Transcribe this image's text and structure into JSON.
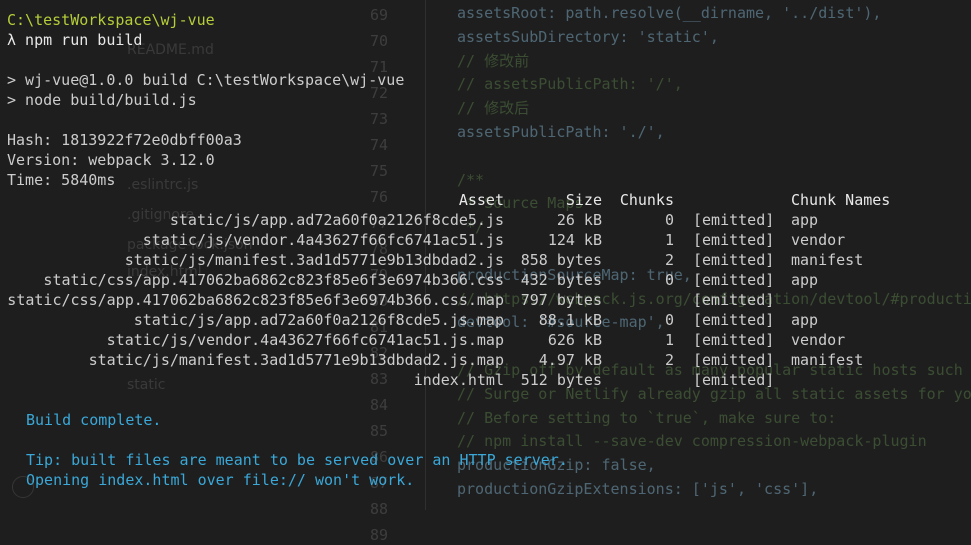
{
  "background": {
    "tree": [
      ".eslintrc.js",
      ".gitignore",
      "package-lock.json",
      "static",
      "README.md",
      "index.html"
    ],
    "gutter": [
      "69",
      "70",
      "71",
      "72",
      "73",
      "74",
      "75",
      "76",
      "77",
      "78",
      "79",
      "80",
      "81",
      "82",
      "83",
      "84",
      "85",
      "86",
      "87",
      "88",
      "89"
    ],
    "code": [
      {
        "t": "assetsRoot: path.resolve(__dirname, '../dist'),",
        "cmt": false
      },
      {
        "t": "assetsSubDirectory: 'static',",
        "cmt": false
      },
      {
        "t": "// 修改前",
        "cmt": true
      },
      {
        "t": "// assetsPublicPath: '/',",
        "cmt": true
      },
      {
        "t": "// 修改后",
        "cmt": true
      },
      {
        "t": "assetsPublicPath: './',",
        "cmt": false
      },
      {
        "t": "",
        "cmt": false
      },
      {
        "t": "/**",
        "cmt": true
      },
      {
        "t": " * Source Maps",
        "cmt": true
      },
      {
        "t": " */",
        "cmt": true
      },
      {
        "t": "",
        "cmt": false
      },
      {
        "t": "productionSourceMap: true,",
        "cmt": false
      },
      {
        "t": "// https://webpack.js.org/configuration/devtool/#production",
        "cmt": true
      },
      {
        "t": "devtool: '#source-map',",
        "cmt": false
      },
      {
        "t": "",
        "cmt": false
      },
      {
        "t": "// Gzip off by default as many popular static hosts such as",
        "cmt": true
      },
      {
        "t": "// Surge or Netlify already gzip all static assets for you.",
        "cmt": true
      },
      {
        "t": "// Before setting to `true`, make sure to:",
        "cmt": true
      },
      {
        "t": "// npm install --save-dev compression-webpack-plugin",
        "cmt": true
      },
      {
        "t": "productionGzip: false,",
        "cmt": false
      },
      {
        "t": "productionGzipExtensions: ['js', 'css'],",
        "cmt": false
      }
    ]
  },
  "terminal": {
    "cwd": "C:\\testWorkspace\\wj-vue",
    "command": "λ npm run build",
    "script_line1": "> wj-vue@1.0.0 build C:\\testWorkspace\\wj-vue",
    "script_line2": "> node build/build.js",
    "hash": "Hash: 1813922f72e0dbff00a3",
    "version": "Version: webpack 3.12.0",
    "time": "Time: 5840ms",
    "headers": {
      "asset": "Asset",
      "size": "Size",
      "chunks": "Chunks",
      "names": "Chunk Names"
    },
    "rows": [
      {
        "asset": "static/js/app.ad72a60f0a2126f8cde5.js",
        "size": "26 kB",
        "chunk": "0",
        "status": "[emitted]",
        "name": "app"
      },
      {
        "asset": "static/js/vendor.4a43627f66fc6741ac51.js",
        "size": "124 kB",
        "chunk": "1",
        "status": "[emitted]",
        "name": "vendor"
      },
      {
        "asset": "static/js/manifest.3ad1d5771e9b13dbdad2.js",
        "size": "858 bytes",
        "chunk": "2",
        "status": "[emitted]",
        "name": "manifest"
      },
      {
        "asset": "static/css/app.417062ba6862c823f85e6f3e6974b366.css",
        "size": "432 bytes",
        "chunk": "0",
        "status": "[emitted]",
        "name": "app"
      },
      {
        "asset": "static/css/app.417062ba6862c823f85e6f3e6974b366.css.map",
        "size": "797 bytes",
        "chunk": "",
        "status": "[emitted]",
        "name": ""
      },
      {
        "asset": "static/js/app.ad72a60f0a2126f8cde5.js.map",
        "size": "88.1 kB",
        "chunk": "0",
        "status": "[emitted]",
        "name": "app"
      },
      {
        "asset": "static/js/vendor.4a43627f66fc6741ac51.js.map",
        "size": "626 kB",
        "chunk": "1",
        "status": "[emitted]",
        "name": "vendor"
      },
      {
        "asset": "static/js/manifest.3ad1d5771e9b13dbdad2.js.map",
        "size": "4.97 kB",
        "chunk": "2",
        "status": "[emitted]",
        "name": "manifest"
      },
      {
        "asset": "index.html",
        "size": "512 bytes",
        "chunk": "",
        "status": "[emitted]",
        "name": ""
      }
    ],
    "build_complete": "Build complete.",
    "tip_line1": "Tip: built files are meant to be served over an HTTP server.",
    "tip_line2": "Opening index.html over file:// won't work."
  }
}
